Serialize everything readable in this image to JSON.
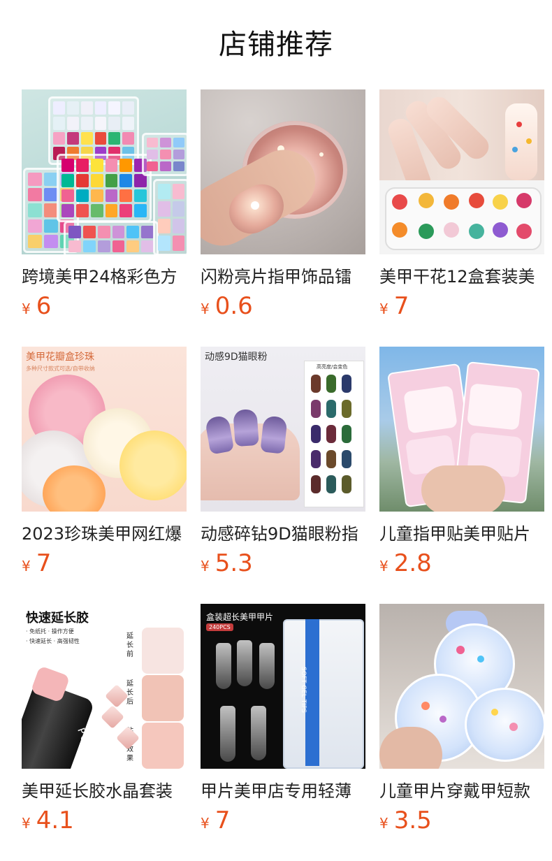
{
  "page": {
    "title": "店铺推荐"
  },
  "products": [
    {
      "name": "跨境美甲24格彩色方",
      "currency": "¥",
      "price": "6"
    },
    {
      "name": "闪粉亮片指甲饰品镭",
      "currency": "¥",
      "price": "0.6"
    },
    {
      "name": "美甲干花12盒套装美",
      "currency": "¥",
      "price": "7"
    },
    {
      "name": "2023珍珠美甲网红爆",
      "currency": "¥",
      "price": "7"
    },
    {
      "name": "动感碎钻9D猫眼粉指",
      "currency": "¥",
      "price": "5.3"
    },
    {
      "name": "儿童指甲贴美甲贴片",
      "currency": "¥",
      "price": "2.8"
    },
    {
      "name": "美甲延长胶水晶套装",
      "currency": "¥",
      "price": "4.1"
    },
    {
      "name": "甲片美甲店专用轻薄",
      "currency": "¥",
      "price": "7"
    },
    {
      "name": "儿童甲片穿戴甲短款",
      "currency": "¥",
      "price": "3.5"
    }
  ],
  "image_text": {
    "pearl": {
      "title": "美甲花瓣盒珍珠",
      "subtitle": "多种尺寸款式可选/自带收纳"
    },
    "cateye": {
      "title": "动感9D猫眼粉",
      "card": "高亮度/会变色"
    },
    "gel": {
      "title": "快速延长胶",
      "bullets": [
        "· 免纸托 · 操作方便",
        "· 快速延长 · 高强韧性"
      ],
      "v1": "延长前",
      "v2": "延长后",
      "v3": "粘钻效果",
      "brand": "POLY"
    },
    "tips": {
      "title": "盒装超长美甲甲片",
      "badge": "240PCS",
      "box": "SOFT GEL TIPS"
    }
  },
  "colors": {
    "price": "#e8501c",
    "title": "#111111"
  }
}
